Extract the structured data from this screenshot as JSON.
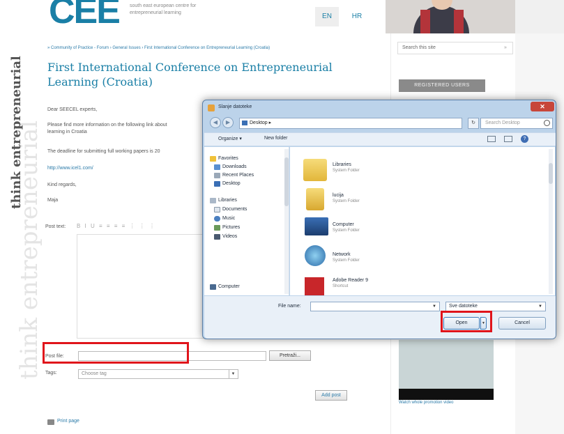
{
  "header": {
    "logo": "CEE",
    "tagline": "south east european centre for entrepreneurial learning",
    "lang_en": "EN",
    "lang_hr": "HR"
  },
  "side_text": {
    "line1": "think entrepreneurial",
    "line2": "think entrepreneurial"
  },
  "main": {
    "breadcrumb": "» Community of Practice - Forum › General Issues › First International Conference on Entrepreneurial Learning (Croatia)",
    "title": "First International Conference on Entrepreneurial Learning (Croatia)",
    "paragraphs": [
      "Dear SEECEL experts,",
      "Please find more information on the following link about",
      "learning in Croatia",
      "The deadline for submitting full working papers is 20",
      "http://www.icel1.com/",
      "Kind regards,",
      "Maja"
    ],
    "post_text_label": "Post text:",
    "editor_toolbar": "B I U ≡ ≡ ≡ ≡ ⋮ ⋮ ⋮",
    "post_file_label": "Post file:",
    "browse_label": "Pretraži...",
    "tags_label": "Tags:",
    "tags_placeholder": "Choose tag",
    "add_post_label": "Add post",
    "print_label": "Print page"
  },
  "sidebar": {
    "search_placeholder": "Search this site",
    "search_arrow": "»",
    "registered_users": "REGISTERED USERS",
    "video_link": "Watch whole promotion video"
  },
  "dialog": {
    "title": "Slanje datoteke",
    "close": "✕",
    "address": "Desktop ▸",
    "refresh": "↻",
    "search_placeholder": "Search Desktop",
    "organize": "Organize ▾",
    "new_folder": "New folder",
    "help": "?",
    "nav": {
      "favorites": "Favorites",
      "downloads": "Downloads",
      "recent": "Recent Places",
      "desktop": "Desktop",
      "libraries": "Libraries",
      "documents": "Documents",
      "music": "Music",
      "pictures": "Pictures",
      "videos": "Videos",
      "computer": "Computer"
    },
    "files": [
      {
        "name": "Libraries",
        "type": "System Folder"
      },
      {
        "name": "lucija",
        "type": "System Folder"
      },
      {
        "name": "Computer",
        "type": "System Folder"
      },
      {
        "name": "Network",
        "type": "System Folder"
      },
      {
        "name": "Adobe Reader 9",
        "type": "Shortcut"
      }
    ],
    "filename_label": "File name:",
    "filetype": "Sve datoteke",
    "open": "Open",
    "cancel": "Cancel"
  },
  "colors": {
    "accent": "#1a7fa6",
    "highlight": "#e0141b",
    "dialog_frame": "#bcd3ea"
  }
}
